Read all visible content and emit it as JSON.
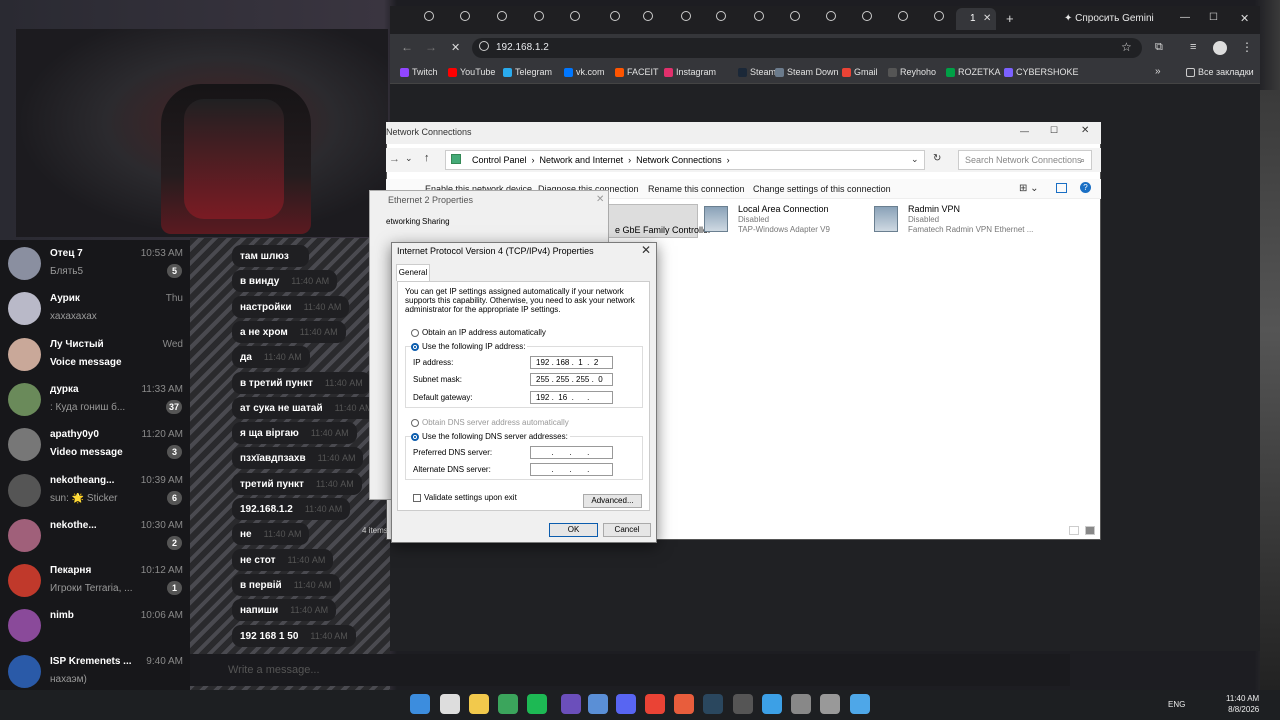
{
  "telegram": {
    "chats": [
      {
        "name": "Отец 7",
        "time": "10:53 AM",
        "preview": "Блять5",
        "badge": "5"
      },
      {
        "name": "Аурик",
        "time": "Thu",
        "preview": "хахахахах",
        "badge": ""
      },
      {
        "name": "Лу Чистый",
        "time": "Wed",
        "preview": "Voice message",
        "badge": ""
      },
      {
        "name": "дурка",
        "time": "11:33 AM",
        "preview": ": Куда гониш б...",
        "badge": "37"
      },
      {
        "name": "apathy0y0",
        "time": "11:20 AM",
        "preview": "Video message",
        "badge": "3"
      },
      {
        "name": "nekotheang...",
        "time": "10:39 AM",
        "preview": "sun: 🌟 Sticker",
        "badge": "6"
      },
      {
        "name": "nekothe...",
        "time": "10:30 AM",
        "preview": "",
        "badge": "2"
      },
      {
        "name": "Пекарня",
        "time": "10:12 AM",
        "preview": "Игроки Terraria, ...",
        "badge": "1"
      },
      {
        "name": "nimb",
        "time": "10:06 AM",
        "preview": "",
        "badge": ""
      },
      {
        "name": "ISP Kremenets ...",
        "time": "9:40 AM",
        "preview": "нахаэм)",
        "badge": ""
      }
    ],
    "messages": [
      {
        "text": "там шлюз",
        "time": ""
      },
      {
        "text": "в винду",
        "time": "11:40 AM"
      },
      {
        "text": "настройки",
        "time": "11:40 AM"
      },
      {
        "text": "а не хром",
        "time": "11:40 AM"
      },
      {
        "text": "да",
        "time": "11:40 AM"
      },
      {
        "text": "в третий пункт",
        "time": "11:40 AM"
      },
      {
        "text": "ат сука не шатай",
        "time": "11:40 AM"
      },
      {
        "text": "я ща віргаю",
        "time": "11:40 AM"
      },
      {
        "text": "пзхїавдпзахв",
        "time": "11:40 AM"
      },
      {
        "text": "третий пункт",
        "time": "11:40 AM"
      },
      {
        "text": "192.168.1.2",
        "time": "11:40 AM"
      },
      {
        "text": "не",
        "time": "11:40 AM"
      },
      {
        "text": "не стот",
        "time": "11:40 AM"
      },
      {
        "text": "в первій",
        "time": "11:40 AM"
      },
      {
        "text": "напиши",
        "time": "11:40 AM"
      },
      {
        "text": "192 168 1 50",
        "time": "11:40 AM"
      }
    ],
    "input_placeholder": "Write a message..."
  },
  "browser": {
    "tab_active": "1",
    "gemini": "✦ Спросить Gemini",
    "url": "192.168.1.2",
    "bookmarks": [
      "Twitch",
      "YouTube",
      "Telegram",
      "vk.com",
      "FACEIT",
      "Instagram",
      "Steam",
      "Steam Down",
      "Gmail",
      "Reyhoho",
      "ROZETKA",
      "CYBERSHOKE"
    ],
    "bookmark_colors": [
      "#9146ff",
      "#ff0000",
      "#2aabee",
      "#0077ff",
      "#ff5500",
      "#e1306c",
      "#1b2838",
      "#6b7b8c",
      "#ea4335",
      "#555555",
      "#00a046",
      "#7b61ff"
    ],
    "all_bookmarks": "Все закладки"
  },
  "explorer": {
    "title": "Network Connections",
    "breadcrumb": [
      "Control Panel",
      "Network and Internet",
      "Network Connections"
    ],
    "search_placeholder": "Search Network Connections",
    "commands": [
      "Enable this network device",
      "Diagnose this connection",
      "Rename this connection",
      "Change settings of this connection"
    ],
    "adapter_partial": "e GbE Family Controller",
    "connections": [
      {
        "name": "Local Area Connection",
        "status": "Disabled",
        "device": "TAP-Windows Adapter V9"
      },
      {
        "name": "Radmin VPN",
        "status": "Disabled",
        "device": "Famatech Radmin VPN Ethernet ..."
      }
    ],
    "item_count": "4 items"
  },
  "eth2": {
    "title": "Ethernet 2 Properties",
    "tab_networking": "etworking",
    "tab_sharing": "Sharing"
  },
  "ipv4": {
    "title": "Internet Protocol Version 4 (TCP/IPv4) Properties",
    "tab": "General",
    "description": "You can get IP settings assigned automatically if your network supports this capability. Otherwise, you need to ask your network administrator for the appropriate IP settings.",
    "obtain_ip_auto": "Obtain an IP address automatically",
    "use_following_ip": "Use the following IP address:",
    "ip_label": "IP address:",
    "ip_value": "192 . 168 .  1  .  2",
    "mask_label": "Subnet mask:",
    "mask_value": "255 . 255 . 255 .  0",
    "gateway_label": "Default gateway:",
    "gateway_value": "192 .  16  .      .",
    "obtain_dns_auto": "Obtain DNS server address automatically",
    "use_following_dns": "Use the following DNS server addresses:",
    "pref_dns_label": "Preferred DNS server:",
    "pref_dns_value": "       .       .       .",
    "alt_dns_label": "Alternate DNS server:",
    "alt_dns_value": "       .       .       .",
    "validate": "Validate settings upon exit",
    "advanced": "Advanced...",
    "ok": "OK",
    "cancel": "Cancel"
  },
  "taskbar": {
    "lang": "ENG",
    "time": "11:40 AM",
    "date": "8/8/2026"
  }
}
